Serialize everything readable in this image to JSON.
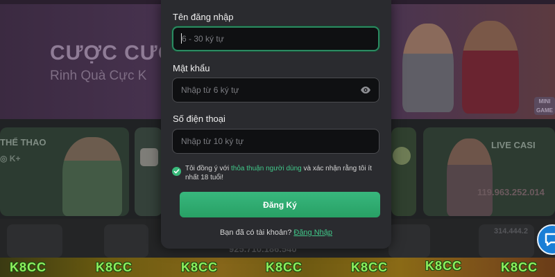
{
  "background": {
    "banner": {
      "title": "CƯỢC CƯỢC",
      "subtitle": "Rinh Quà Cực K",
      "mini_game_label": "MINI GAME"
    },
    "cards": {
      "sports_title": "THỂ THAO",
      "sports_brands": "◎ K+",
      "live_casino_title": "LIVE CASI",
      "live_casino_jackpot": "119.963.252.014"
    },
    "strip": {
      "jackpot_center": "925.710.186.540",
      "jackpot_right": "314.444.2"
    },
    "brand_repeats": [
      "K8CC",
      "K8CC",
      "K8CC",
      "K8CC",
      "K8CC",
      "K8CC",
      "K8CC"
    ]
  },
  "form": {
    "username": {
      "label": "Tên đăng nhập",
      "placeholder": "6 - 30 ký tự",
      "value": ""
    },
    "password": {
      "label": "Mật khẩu",
      "placeholder": "Nhập từ 6 ký tự",
      "value": "",
      "toggle_icon": "eye-icon"
    },
    "phone": {
      "label": "Số điện thoại",
      "placeholder": "Nhập từ 10 ký tự",
      "value": ""
    },
    "agreement": {
      "checked": true,
      "prefix": "Tôi đồng ý với ",
      "link": "thỏa thuận người dùng",
      "suffix": " và xác nhận rằng tôi ít nhất 18 tuổi!"
    },
    "submit_label": "Đăng Ký",
    "login_prompt": "Bạn đã có tài khoản? ",
    "login_link": "Đăng Nhập"
  },
  "colors": {
    "accent_green": "#39b97a",
    "link_green": "#41c98a",
    "modal_bg": "#2a2b2f",
    "input_bg": "#0f1012",
    "chat_blue": "#1a7ed6",
    "brand_green": "#8cf05e"
  },
  "chat_widget": {
    "icon": "chat-bubble-icon"
  }
}
